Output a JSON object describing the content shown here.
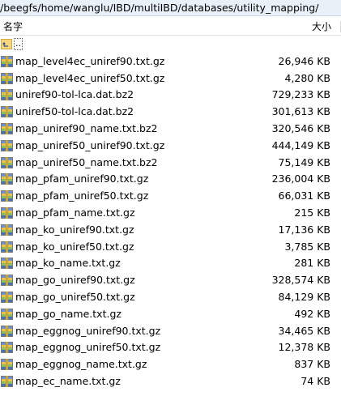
{
  "path": {
    "text": "/beegfs/home/wanglu/IBD/multiIBD/databases/utility_mapping/"
  },
  "columns": {
    "name": "名字",
    "size": "大小"
  },
  "parent_entry": {
    "label": ".."
  },
  "files": [
    {
      "name": "map_level4ec_uniref90.txt.gz",
      "size": "26,946 KB"
    },
    {
      "name": "map_level4ec_uniref50.txt.gz",
      "size": "4,280 KB"
    },
    {
      "name": "uniref90-tol-lca.dat.bz2",
      "size": "729,233 KB"
    },
    {
      "name": "uniref50-tol-lca.dat.bz2",
      "size": "301,613 KB"
    },
    {
      "name": "map_uniref90_name.txt.bz2",
      "size": "320,546 KB"
    },
    {
      "name": "map_uniref50_uniref90.txt.gz",
      "size": "444,149 KB"
    },
    {
      "name": "map_uniref50_name.txt.bz2",
      "size": "75,149 KB"
    },
    {
      "name": "map_pfam_uniref90.txt.gz",
      "size": "236,004 KB"
    },
    {
      "name": "map_pfam_uniref50.txt.gz",
      "size": "66,031 KB"
    },
    {
      "name": "map_pfam_name.txt.gz",
      "size": "215 KB"
    },
    {
      "name": "map_ko_uniref90.txt.gz",
      "size": "17,136 KB"
    },
    {
      "name": "map_ko_uniref50.txt.gz",
      "size": "3,785 KB"
    },
    {
      "name": "map_ko_name.txt.gz",
      "size": "281 KB"
    },
    {
      "name": "map_go_uniref90.txt.gz",
      "size": "328,574 KB"
    },
    {
      "name": "map_go_uniref50.txt.gz",
      "size": "84,129 KB"
    },
    {
      "name": "map_go_name.txt.gz",
      "size": "492 KB"
    },
    {
      "name": "map_eggnog_uniref90.txt.gz",
      "size": "34,465 KB"
    },
    {
      "name": "map_eggnog_uniref50.txt.gz",
      "size": "12,378 KB"
    },
    {
      "name": "map_eggnog_name.txt.gz",
      "size": "837 KB"
    },
    {
      "name": "map_ec_name.txt.gz",
      "size": "74 KB"
    }
  ],
  "icons": {
    "parent": "folder-up-icon",
    "file": "archive-file-icon"
  },
  "colors": {
    "pathbar_bg": "#e8f0f8",
    "row_text": "#000000"
  }
}
